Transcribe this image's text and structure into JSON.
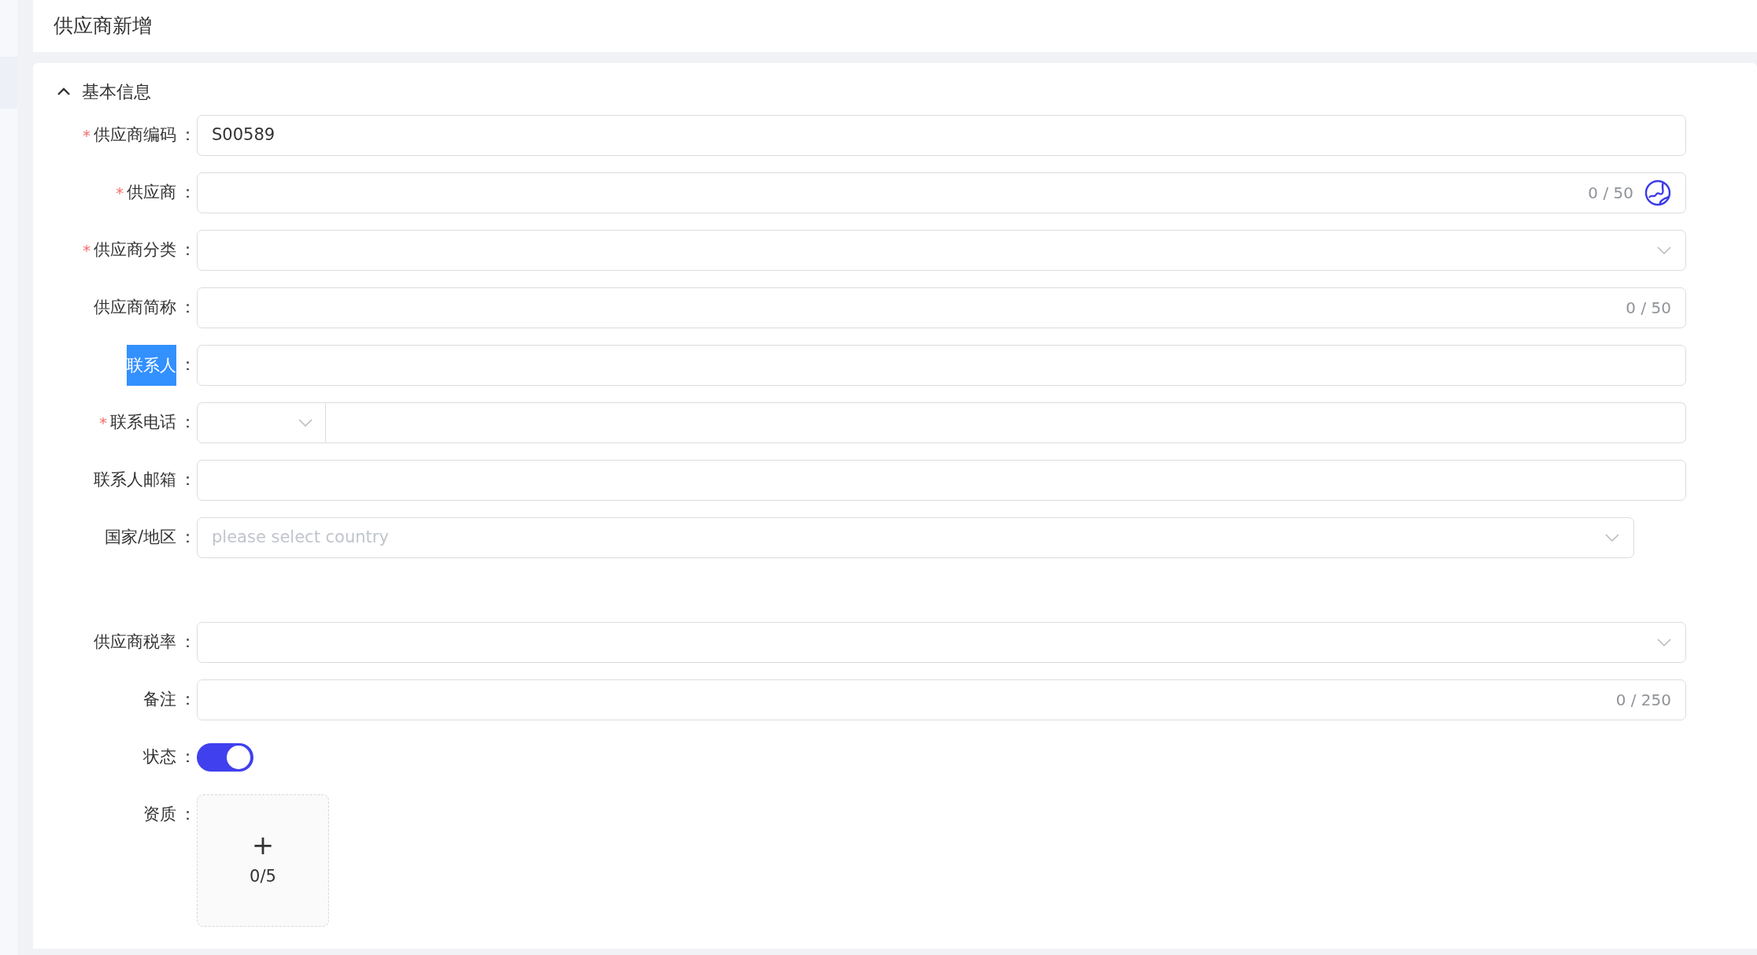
{
  "page_title": "供应商新增",
  "section": {
    "title": "基本信息",
    "expanded": true
  },
  "fields": [
    {
      "kind": "text",
      "asterisk": "*",
      "label": "供应商编码",
      "colon": "：",
      "highlighted": false,
      "value": "S00589"
    },
    {
      "kind": "text",
      "asterisk": "*",
      "label": "供应商",
      "colon": "：",
      "highlighted": false,
      "counter": "0 / 50",
      "globe": true
    },
    {
      "kind": "select",
      "asterisk": "*",
      "label": "供应商分类",
      "colon": "：",
      "highlighted": false
    },
    {
      "kind": "text",
      "label": "供应商简称",
      "colon": "：",
      "highlighted": false,
      "counter": "0 / 50"
    },
    {
      "kind": "text",
      "label": "联系人",
      "colon": "：",
      "highlighted": true
    },
    {
      "kind": "phone",
      "asterisk": "*",
      "label": "联系电话",
      "colon": "：",
      "highlighted": false
    },
    {
      "kind": "text",
      "label": "联系人邮箱",
      "colon": "：",
      "highlighted": false
    },
    {
      "kind": "country",
      "label": "国家/地区",
      "colon": "：",
      "highlighted": false,
      "placeholder": "please select country"
    },
    {
      "kind": "select",
      "label": "供应商税率",
      "colon": "：",
      "highlighted": false
    },
    {
      "kind": "text",
      "label": "备注",
      "colon": "：",
      "highlighted": false,
      "counter": "0 / 250"
    },
    {
      "kind": "switch",
      "label": "状态",
      "colon": "：",
      "highlighted": false,
      "on": true
    },
    {
      "kind": "upload",
      "label": "资质",
      "colon": "：",
      "highlighted": false,
      "plus": "+",
      "count": "0/5"
    }
  ]
}
